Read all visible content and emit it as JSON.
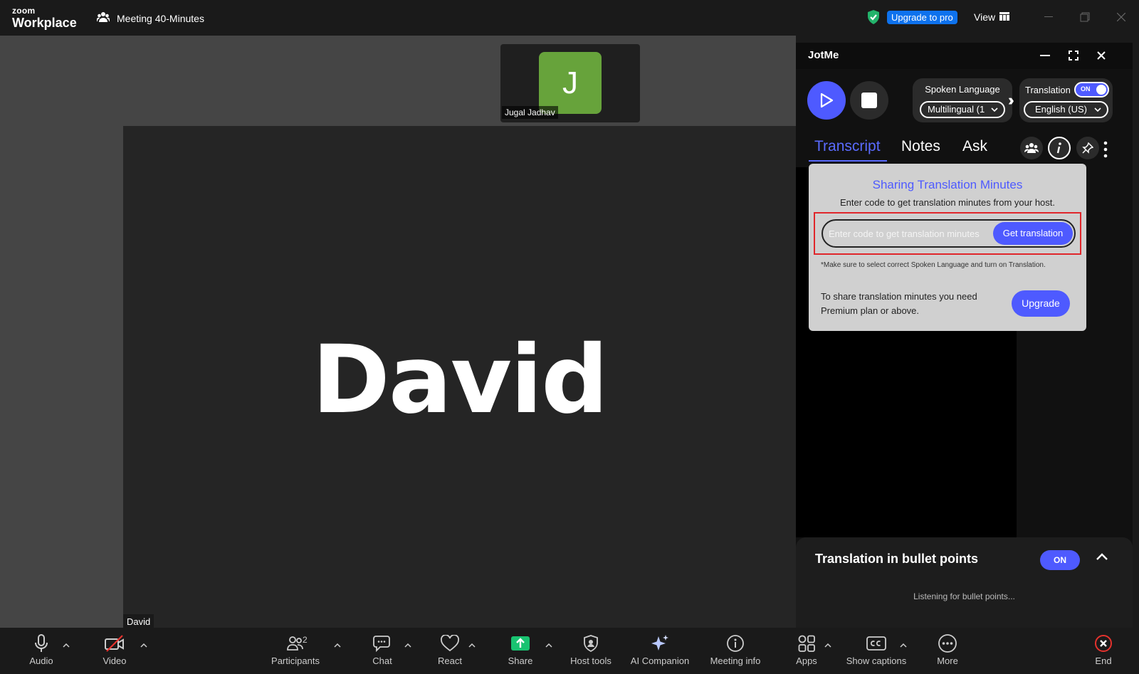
{
  "app": {
    "logo_line1": "zoom",
    "logo_line2": "Workplace",
    "meeting_title": "Meeting 40-Minutes",
    "upgrade_label": "Upgrade to pro",
    "view_label": "View"
  },
  "stage": {
    "thumb_initial": "J",
    "thumb_name": "Jugal Jadhav",
    "thumb_avatar_color": "#67a33b",
    "main_name_big": "David",
    "main_name_tag": "David"
  },
  "jotme": {
    "title": "JotMe",
    "spoken_language_label": "Spoken Language",
    "spoken_language_value": "Multilingual (1",
    "translation_label": "Translation",
    "toggle_text": "ON",
    "translation_value": "English (US)",
    "tabs": [
      {
        "label": "Transcript",
        "active": true
      },
      {
        "label": "Notes",
        "active": false
      },
      {
        "label": "Ask",
        "active": false
      }
    ],
    "popup": {
      "title": "Sharing Translation Minutes",
      "subtitle": "Enter code to get translation minutes from your host.",
      "input_placeholder": "Enter code to get translation minutes",
      "input_value": "",
      "get_button": "Get translation",
      "note": "*Make sure to select correct Spoken Language and turn on Translation.",
      "share_text": "To share translation minutes you need Premium plan or above.",
      "upgrade_button": "Upgrade"
    },
    "bullets": {
      "title": "Translation in bullet points",
      "toggle": "ON",
      "status": "Listening for bullet points..."
    },
    "accent_color": "#4e5aff"
  },
  "toolbar": {
    "audio": "Audio",
    "video": "Video",
    "participants": "Participants",
    "participants_count": "2",
    "chat": "Chat",
    "react": "React",
    "share": "Share",
    "host_tools": "Host tools",
    "ai_companion": "AI Companion",
    "meeting_info": "Meeting info",
    "apps": "Apps",
    "show_captions": "Show captions",
    "more": "More",
    "end": "End"
  }
}
